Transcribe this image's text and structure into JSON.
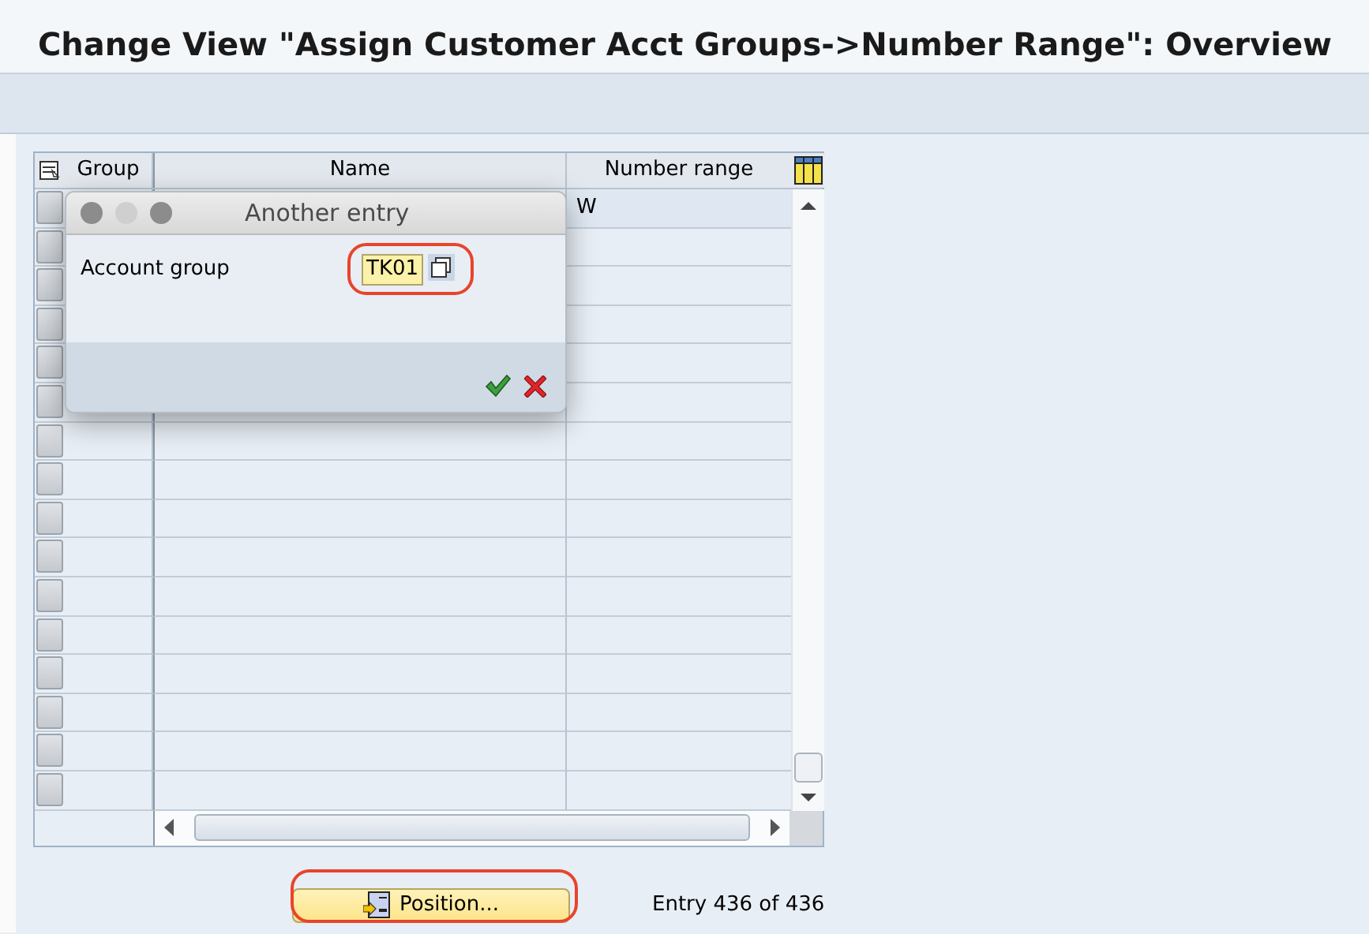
{
  "window": {
    "title": "Change View \"Assign Customer Acct Groups->Number Range\": Overview"
  },
  "table": {
    "columns": [
      "Group",
      "Name",
      "Number range"
    ],
    "rows": [
      {
        "number_range": "W"
      }
    ]
  },
  "dialog": {
    "title": "Another entry",
    "field_label": "Account group",
    "field_value": "TK01"
  },
  "position_button": {
    "label": "Position..."
  },
  "entry_info": "Entry 436 of 436"
}
